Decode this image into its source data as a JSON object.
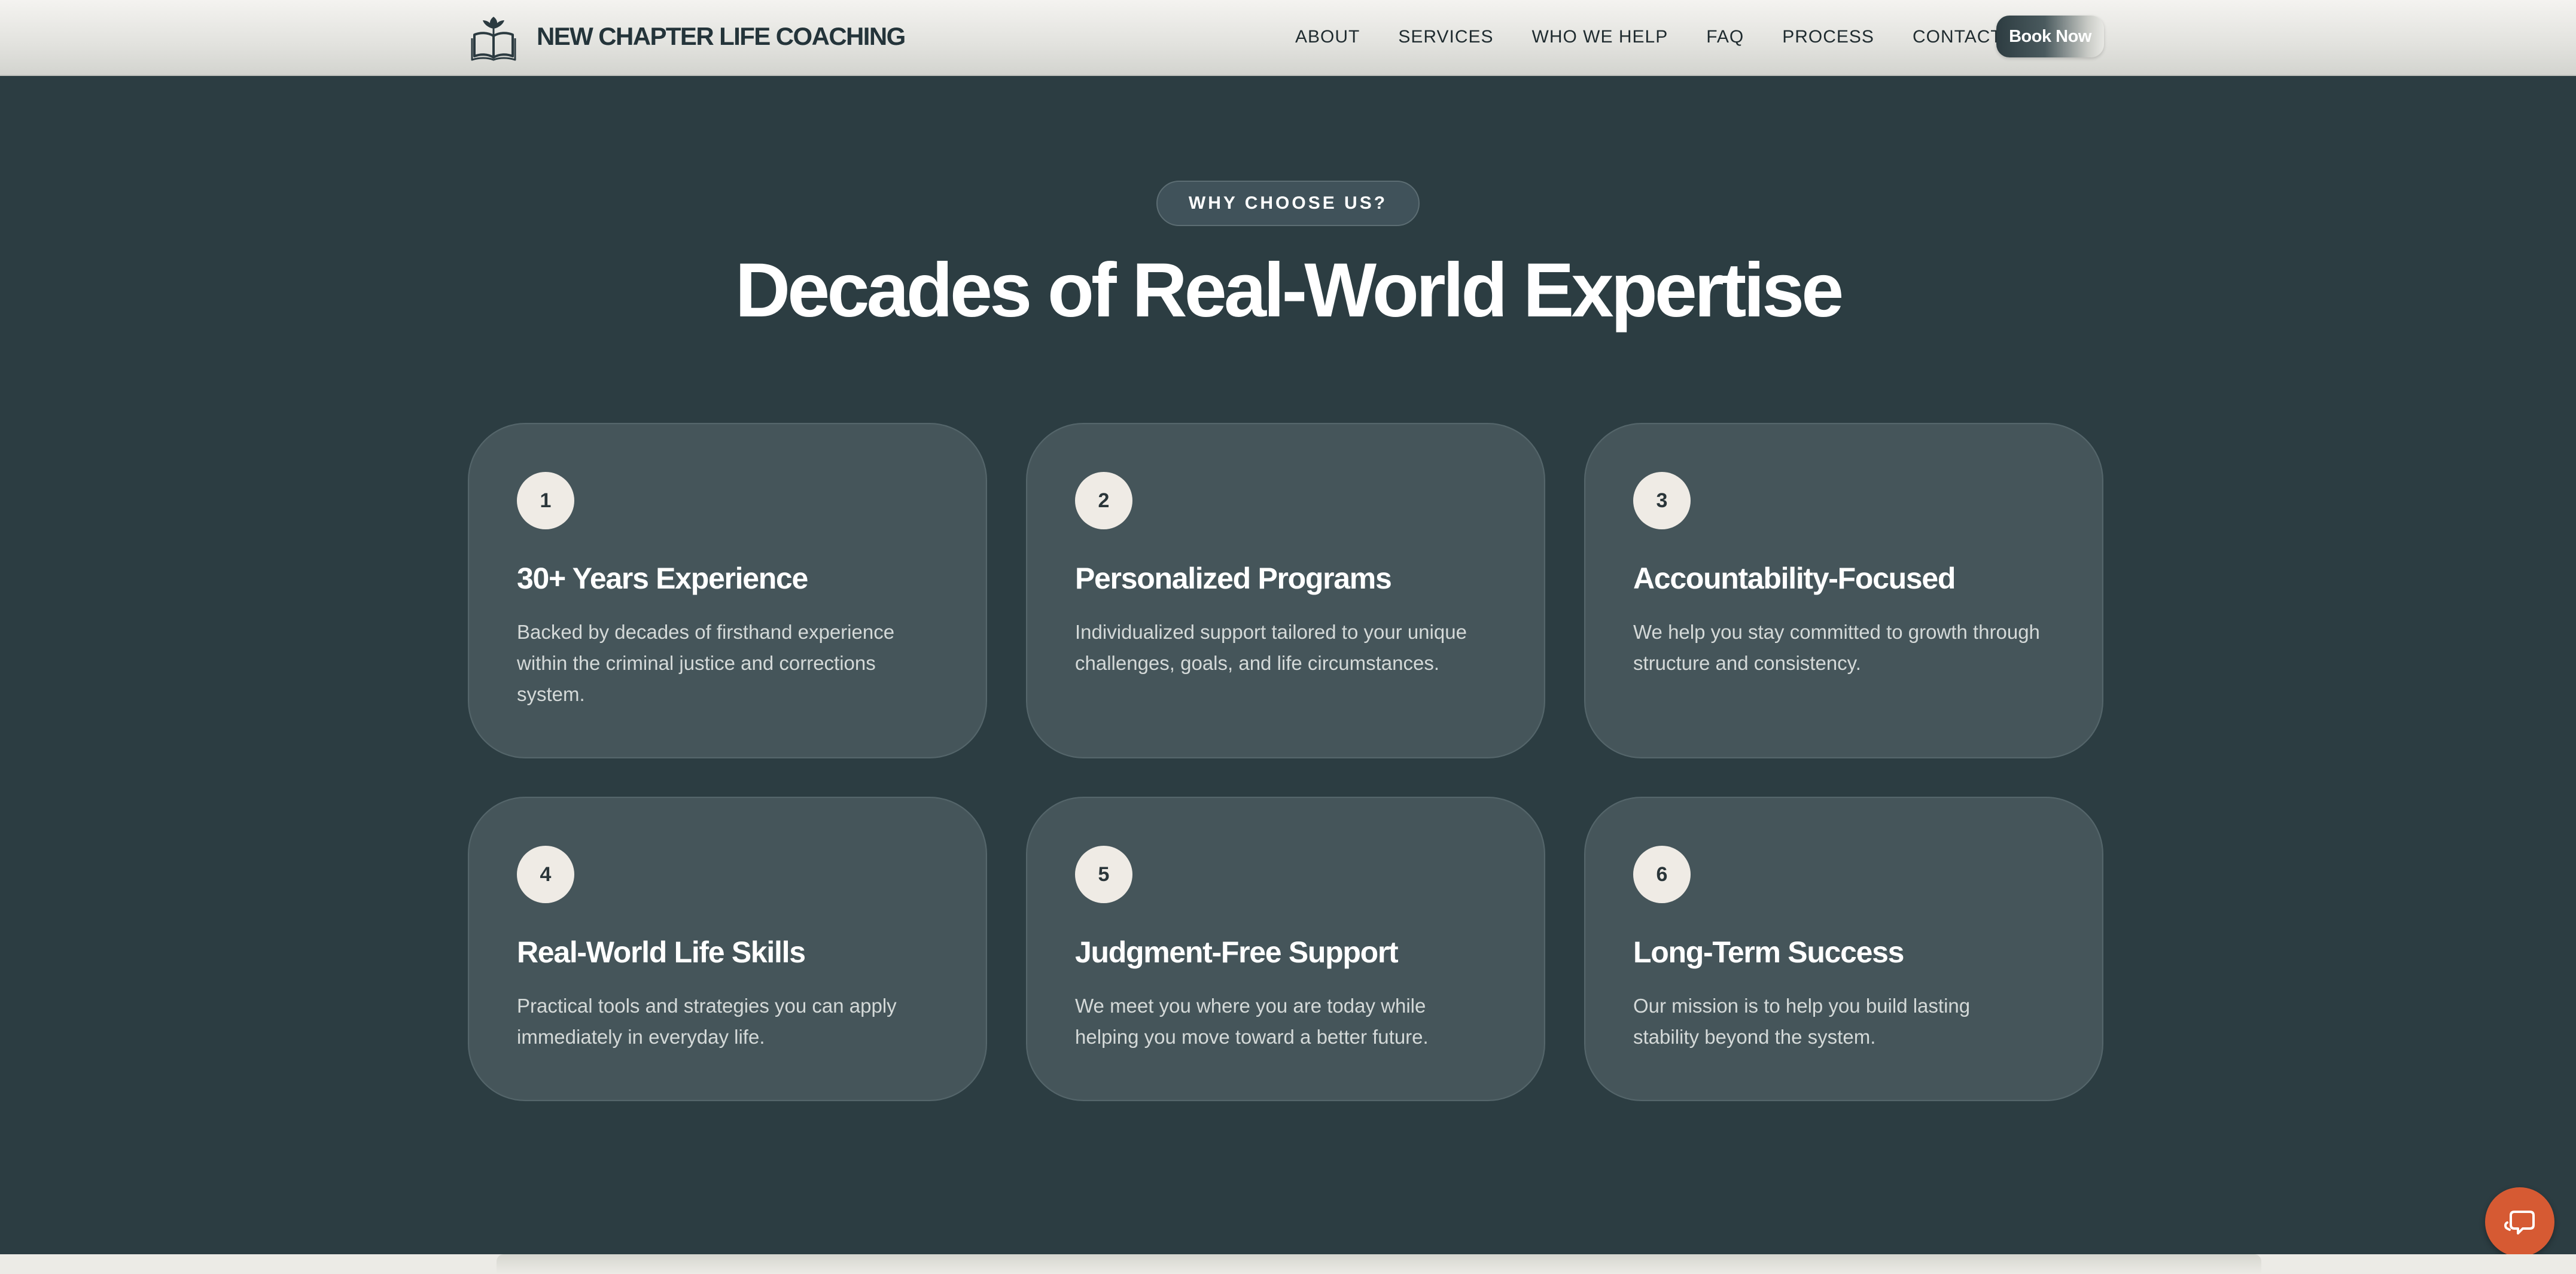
{
  "header": {
    "brand_name": "NEW CHAPTER LIFE COACHING",
    "logo_icon": "open-book-sprout-icon",
    "nav": [
      {
        "label": "ABOUT"
      },
      {
        "label": "SERVICES"
      },
      {
        "label": "WHO WE HELP"
      },
      {
        "label": "FAQ"
      },
      {
        "label": "PROCESS"
      },
      {
        "label": "CONTACT"
      }
    ],
    "cta_label": "Book Now"
  },
  "section": {
    "badge": "WHY CHOOSE US?",
    "title": "Decades of Real-World Expertise"
  },
  "cards": [
    {
      "number": "1",
      "title": "30+ Years Experience",
      "description": "Backed by decades of firsthand experience within the criminal justice and corrections system."
    },
    {
      "number": "2",
      "title": "Personalized Programs",
      "description": "Individualized support tailored to your unique challenges, goals, and life circumstances."
    },
    {
      "number": "3",
      "title": "Accountability-Focused",
      "description": "We help you stay committed to growth through structure and consistency."
    },
    {
      "number": "4",
      "title": "Real-World Life Skills",
      "description": "Practical tools and strategies you can apply immediately in everyday life."
    },
    {
      "number": "5",
      "title": "Judgment-Free Support",
      "description": "We meet you where you are today while helping you move toward a better future."
    },
    {
      "number": "6",
      "title": "Long-Term Success",
      "description": "Our mission is to help you build lasting stability beyond the system."
    }
  ],
  "chat": {
    "icon": "chat-bubble-icon"
  },
  "colors": {
    "background": "#2c3d42",
    "card": "#45555a",
    "accent": "#d65a33",
    "number_circle": "#efebe5"
  }
}
